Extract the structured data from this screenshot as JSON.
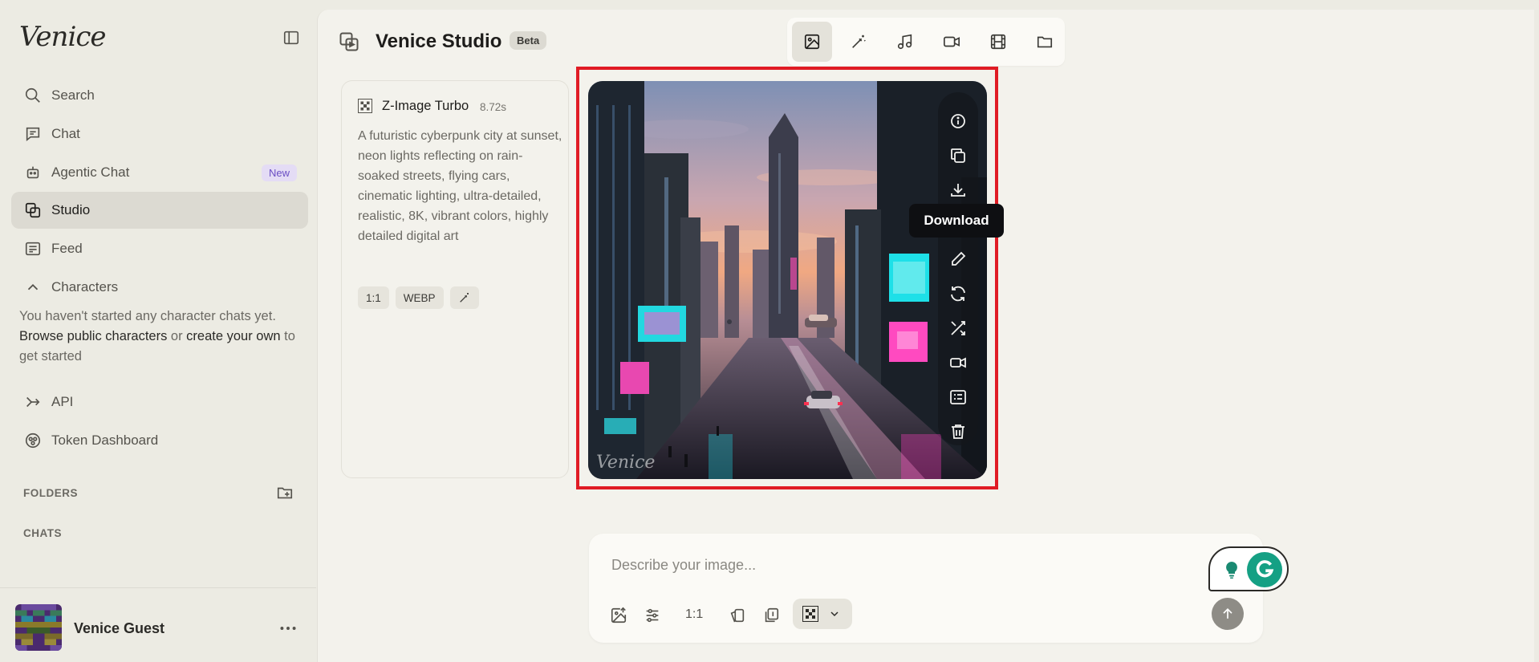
{
  "sidebar": {
    "logo": "Venice",
    "items": [
      {
        "label": "Search"
      },
      {
        "label": "Chat"
      },
      {
        "label": "Agentic Chat",
        "badge": "New"
      },
      {
        "label": "Studio"
      },
      {
        "label": "Feed"
      },
      {
        "label": "Characters"
      },
      {
        "label": "API"
      },
      {
        "label": "Token Dashboard"
      }
    ],
    "characters_note": {
      "before": "You haven't started any character chats yet.",
      "browse_link": "Browse public characters",
      "or": " or ",
      "create_link": "create your own",
      "after": " to get started"
    },
    "folders_label": "FOLDERS",
    "chats_label": "CHATS",
    "user_name": "Venice Guest"
  },
  "header": {
    "title": "Venice Studio",
    "badge": "Beta"
  },
  "card": {
    "model_name": "Z-Image Turbo",
    "time": "8.72s",
    "prompt": "A futuristic cyberpunk city at sunset, neon lights reflecting on rain-soaked streets, flying cars, cinematic lighting, ultra-detailed, realistic, 8K, vibrant colors, highly detailed digital art",
    "chips": [
      "1:1",
      "WEBP"
    ]
  },
  "image_tooltip": "Download",
  "image_watermark": "Venice",
  "composer": {
    "placeholder": "Describe your image...",
    "ratio": "1:1"
  }
}
